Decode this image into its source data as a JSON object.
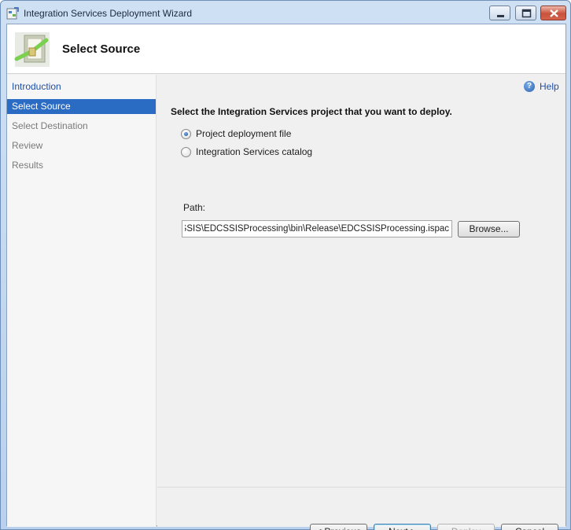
{
  "window": {
    "title": "Integration Services Deployment Wizard"
  },
  "header": {
    "title": "Select Source"
  },
  "nav": {
    "items": [
      {
        "label": "Introduction"
      },
      {
        "label": "Select Source"
      },
      {
        "label": "Select Destination"
      },
      {
        "label": "Review"
      },
      {
        "label": "Results"
      }
    ]
  },
  "content": {
    "help_label": "Help",
    "prompt": "Select the Integration Services project that you want to deploy.",
    "options": [
      {
        "label": "Project deployment file",
        "checked": true
      },
      {
        "label": "Integration Services catalog",
        "checked": false
      }
    ],
    "path_label": "Path:",
    "path_value": "EDCSSIS\\EDCSSISProcessing\\bin\\Release\\EDCSSISProcessing.ispac",
    "browse_label": "Browse..."
  },
  "footer": {
    "previous_label": "< Previous",
    "next_label": "Next >",
    "deploy_label": "Deploy",
    "cancel_label": "Cancel"
  }
}
